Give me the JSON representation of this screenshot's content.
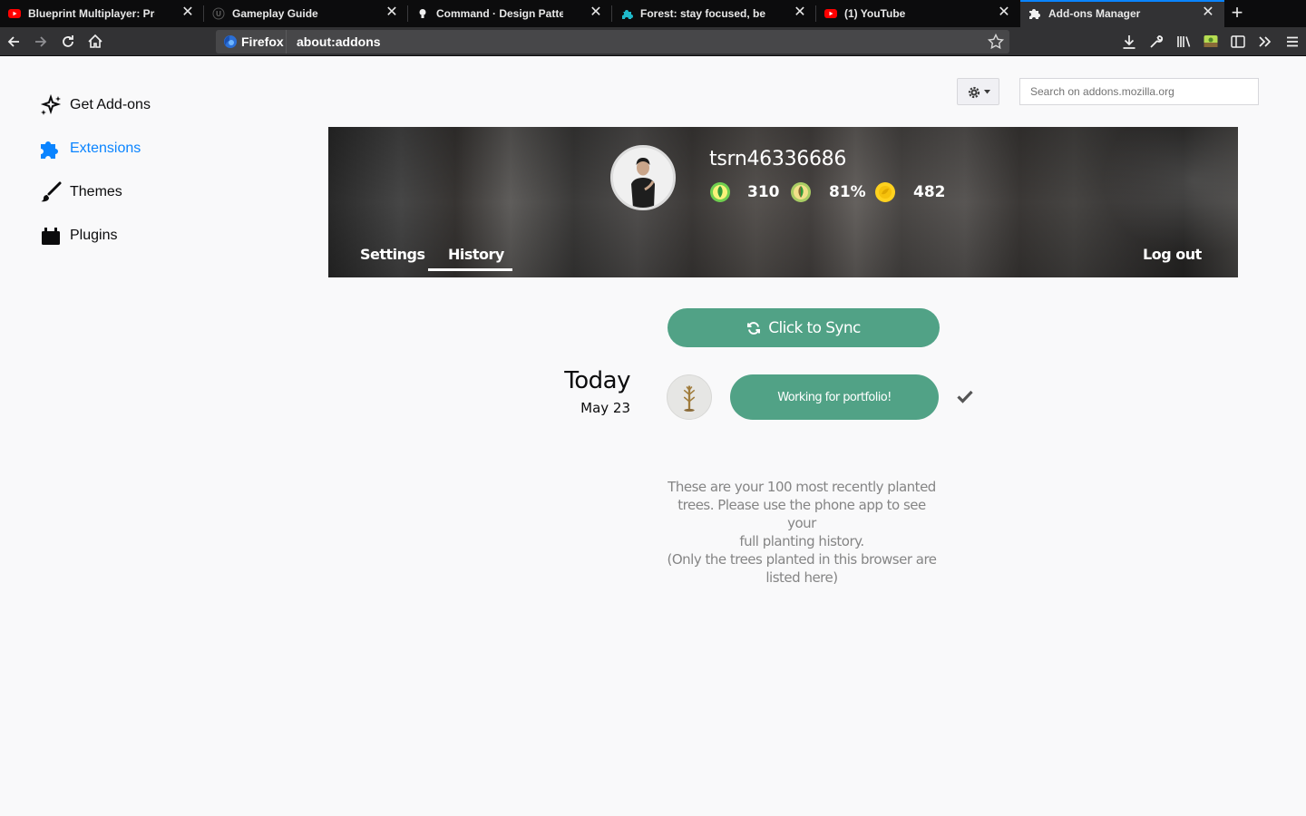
{
  "tabs": [
    {
      "title": "Blueprint Multiplayer: Project O",
      "favicon": "youtube-icon",
      "active": false
    },
    {
      "title": "Gameplay Guide",
      "favicon": "unreal-icon",
      "active": false
    },
    {
      "title": "Command · Design Patterns Re",
      "favicon": "bulb-icon",
      "active": false
    },
    {
      "title": "Forest: stay focused, be present",
      "favicon": "forest-puzzle-icon",
      "active": false
    },
    {
      "title": "(1) YouTube",
      "favicon": "youtube-icon",
      "active": false
    },
    {
      "title": "Add-ons Manager",
      "favicon": "puzzle-icon",
      "active": true
    }
  ],
  "navbar": {
    "identity_label": "Firefox",
    "url": "about:addons"
  },
  "sidebar": {
    "items": [
      {
        "label": "Get Add-ons",
        "icon": "get-addons-icon",
        "selected": false
      },
      {
        "label": "Extensions",
        "icon": "puzzle-icon",
        "selected": true
      },
      {
        "label": "Themes",
        "icon": "brush-icon",
        "selected": false
      },
      {
        "label": "Plugins",
        "icon": "plugin-icon",
        "selected": false
      }
    ]
  },
  "tools": {
    "search_placeholder": "Search on addons.mozilla.org"
  },
  "forest": {
    "username": "tsrn46336686",
    "stats": {
      "trees": "310",
      "success_rate": "81%",
      "coins": "482"
    },
    "tabs": {
      "settings": "Settings",
      "history": "History",
      "logout": "Log out"
    },
    "sync_label": "Click to Sync",
    "history": {
      "day_label": "Today",
      "date": "May 23",
      "session_label": "Working for portfolio!"
    },
    "note_lines": [
      "These are your 100 most recently planted",
      "trees. Please use the phone app to see your",
      "full planting history.",
      "(Only the trees planted in this browser are",
      "listed here)"
    ]
  },
  "colors": {
    "accent": "#0a84ff",
    "forest_green": "#51a286",
    "tab_bg": "#0c0c0d",
    "toolbar_bg": "#323234"
  }
}
